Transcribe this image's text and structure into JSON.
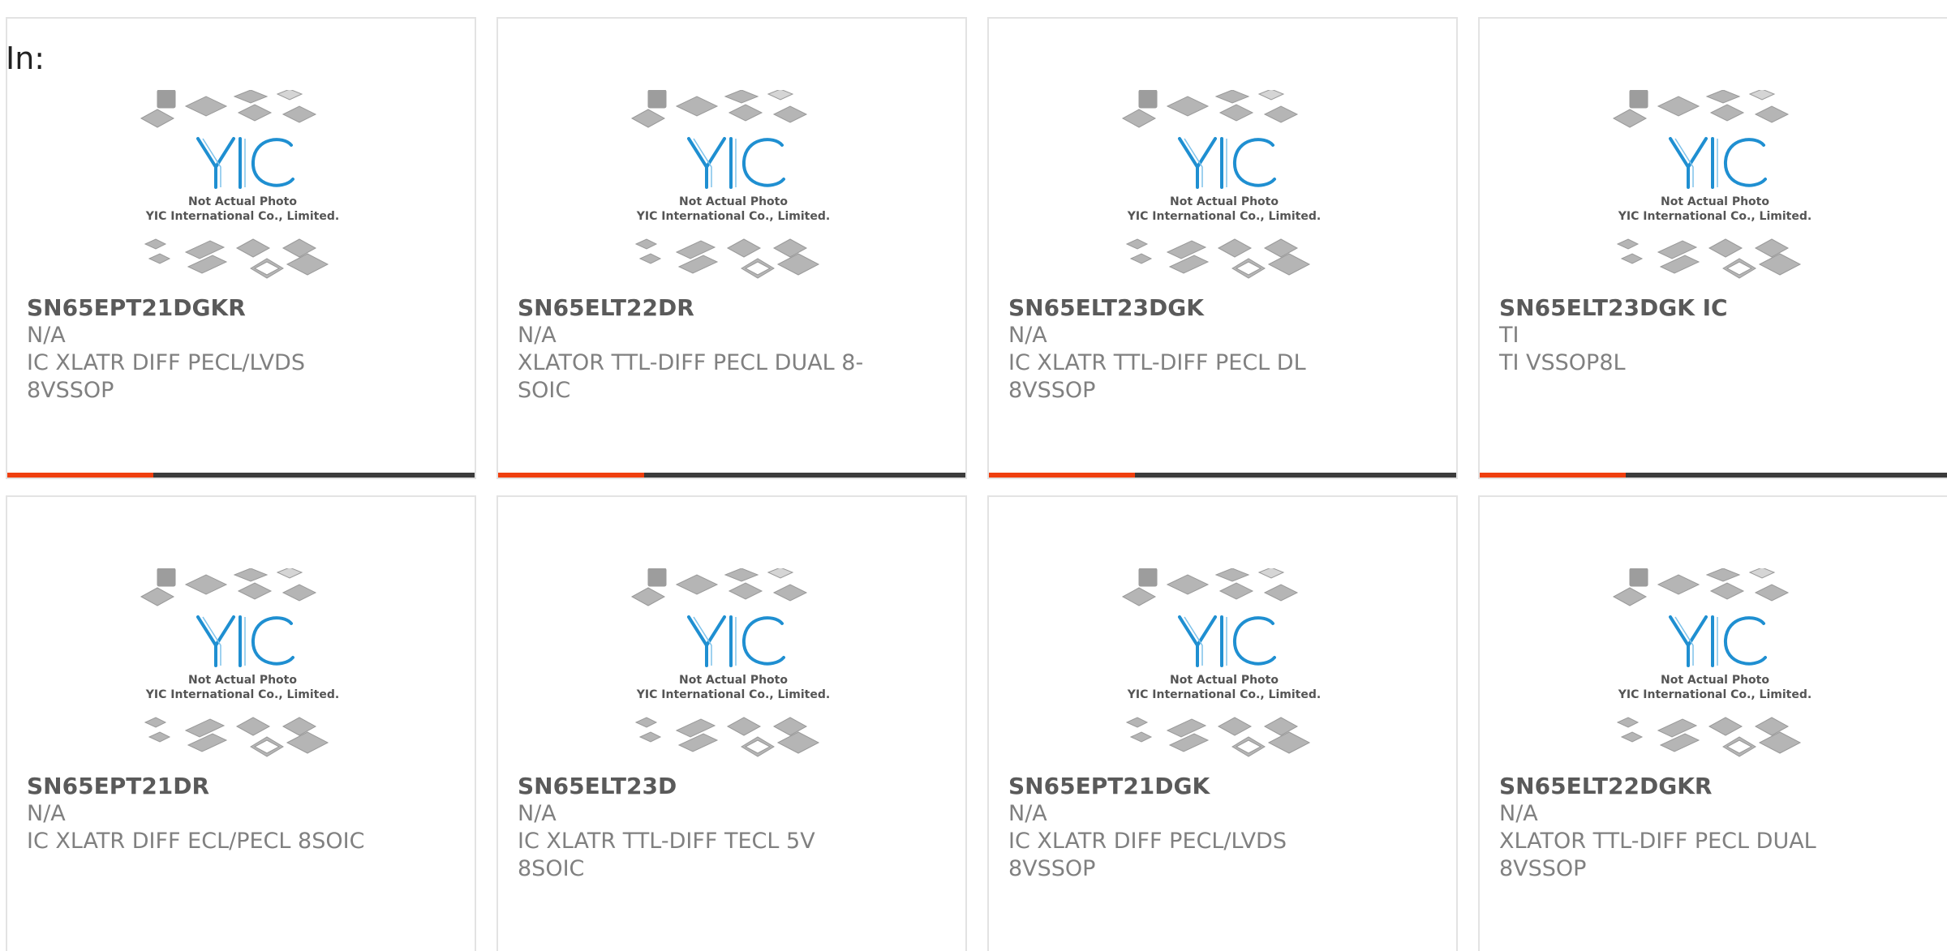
{
  "header": {
    "label": "In:"
  },
  "thumbnail": {
    "caption_line1": "Not Actual Photo",
    "caption_line2": "YIC International Co., Limited.",
    "logo_text": "YIC"
  },
  "colors": {
    "accent": "#ef3f0f",
    "bar_dark": "#3b3b3b",
    "logo_blue": "#1f8fd1",
    "chip_gray": "#b5b5b5"
  },
  "products": [
    {
      "part": "SN65EPT21DGKR",
      "manufacturer": "N/A",
      "desc_line1": "IC XLATR DIFF PECL/LVDS",
      "desc_line2": "8VSSOP",
      "has_accent_bar": true
    },
    {
      "part": "SN65ELT22DR",
      "manufacturer": "N/A",
      "desc_line1": "XLATOR TTL-DIFF PECL DUAL 8-",
      "desc_line2": "SOIC",
      "has_accent_bar": true
    },
    {
      "part": "SN65ELT23DGK",
      "manufacturer": "N/A",
      "desc_line1": "IC XLATR TTL-DIFF PECL DL",
      "desc_line2": "8VSSOP",
      "has_accent_bar": true
    },
    {
      "part": "SN65ELT23DGK IC",
      "manufacturer": "TI",
      "desc_line1": "TI VSSOP8L",
      "desc_line2": "",
      "has_accent_bar": true
    },
    {
      "part": "SN65EPT21DR",
      "manufacturer": "N/A",
      "desc_line1": "IC XLATR DIFF ECL/PECL 8SOIC",
      "desc_line2": "",
      "has_accent_bar": false
    },
    {
      "part": "SN65ELT23D",
      "manufacturer": "N/A",
      "desc_line1": "IC XLATR TTL-DIFF TECL 5V",
      "desc_line2": "8SOIC",
      "has_accent_bar": false
    },
    {
      "part": "SN65EPT21DGK",
      "manufacturer": "N/A",
      "desc_line1": "IC XLATR DIFF PECL/LVDS",
      "desc_line2": "8VSSOP",
      "has_accent_bar": false
    },
    {
      "part": "SN65ELT22DGKR",
      "manufacturer": "N/A",
      "desc_line1": "XLATOR TTL-DIFF PECL DUAL",
      "desc_line2": "8VSSOP",
      "has_accent_bar": false
    }
  ]
}
